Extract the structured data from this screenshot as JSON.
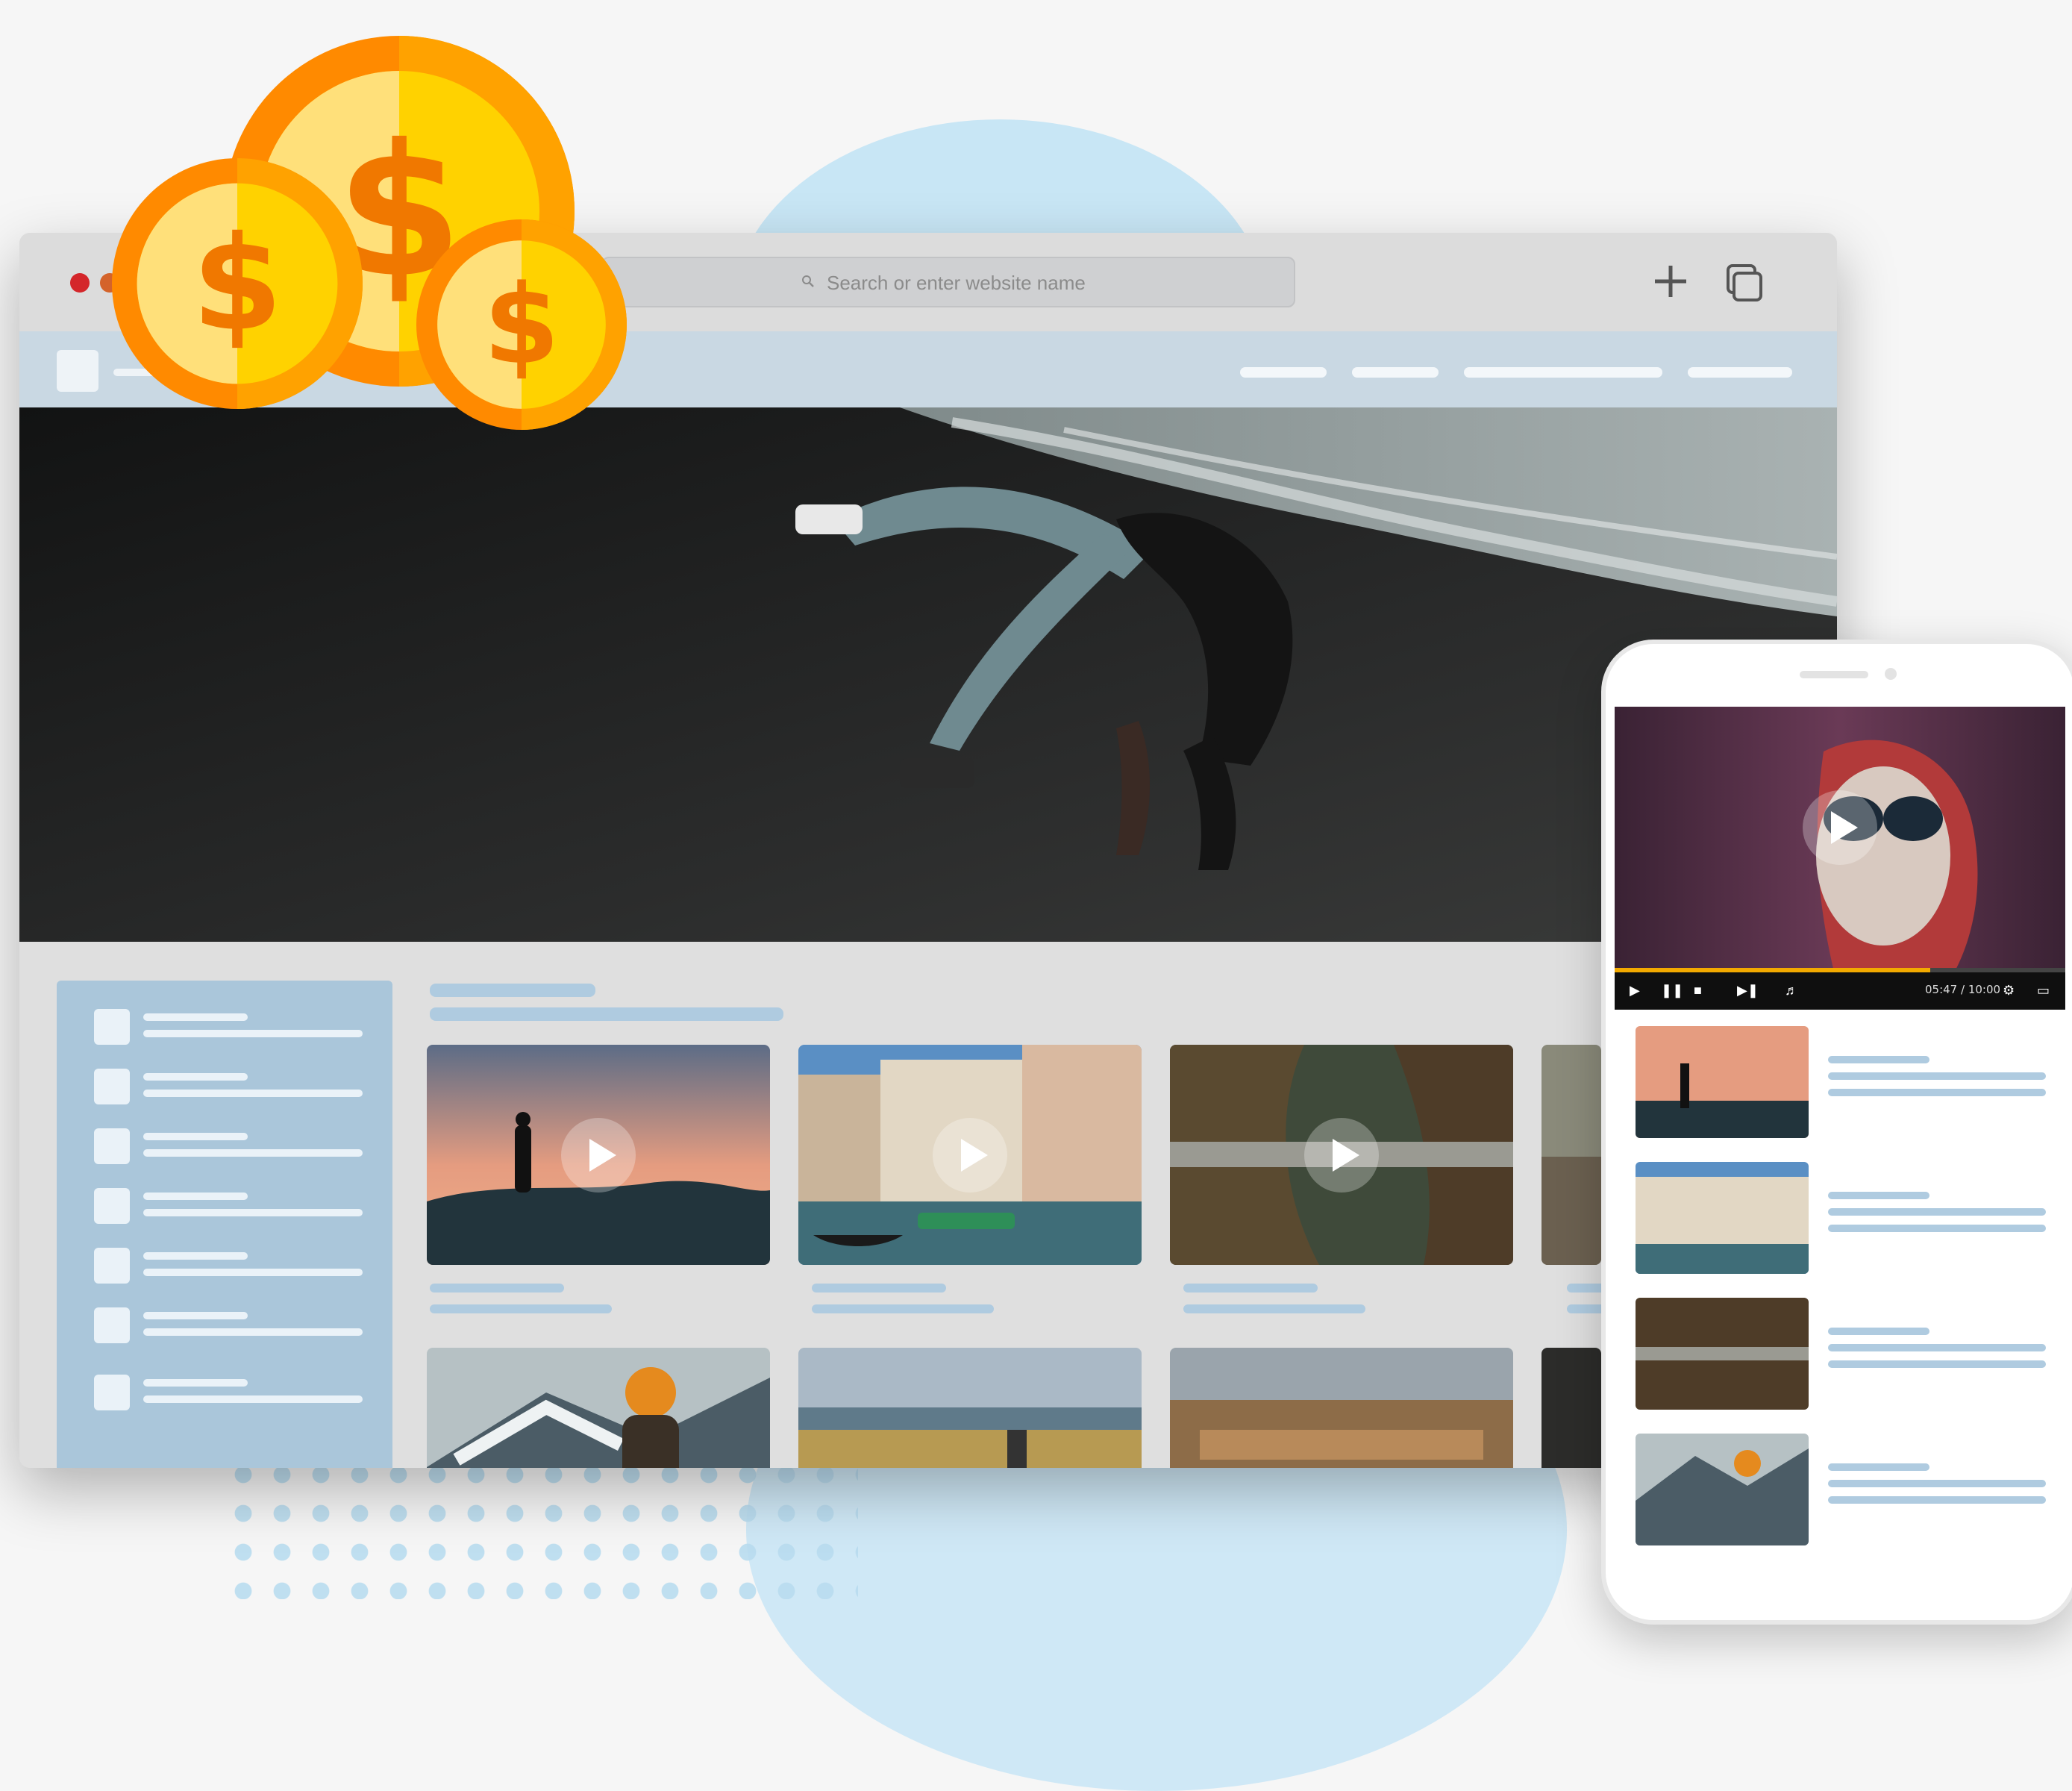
{
  "browser": {
    "address_placeholder": "Search or enter website name",
    "forward_glyph": ">",
    "new_tab_glyph": "+",
    "icons": [
      "search-icon",
      "plus-icon",
      "tabs-icon",
      "chevron-right-icon"
    ]
  },
  "video_player": {
    "time": "05:47 / 10:00",
    "progress": 0.7
  },
  "colors": {
    "accent": "#f2a900",
    "nav_bar": "#c9d8e3",
    "skeleton": "#afcbe0",
    "coin_gold": "#ffd200",
    "coin_orange": "#ff8a00"
  },
  "coins": {
    "symbol": "$"
  }
}
